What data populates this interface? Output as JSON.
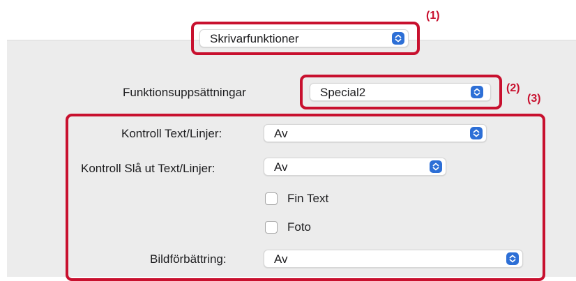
{
  "top_popup": {
    "value": "Skrivarfunktioner",
    "icon": "up-down-chevron-icon"
  },
  "feature_sets": {
    "label": "Funktionsuppsättningar",
    "value": "Special2",
    "icon": "up-down-chevron-icon"
  },
  "settings": {
    "text_lines_control": {
      "label": "Kontroll Text/Linjer:",
      "value": "Av"
    },
    "knockout_text_lines": {
      "label": "Kontroll Slå ut Text/Linjer:",
      "value": "Av"
    },
    "fine_text": {
      "label": "Fin Text",
      "checked": false
    },
    "photo": {
      "label": "Foto",
      "checked": false
    },
    "image_enhancement": {
      "label": "Bildförbättring:",
      "value": "Av"
    }
  },
  "callouts": {
    "c1": "(1)",
    "c2": "(2)",
    "c3": "(3)"
  },
  "colors": {
    "callout_red": "#c8102e",
    "accent_blue": "#2d6fd6",
    "panel_bg": "#ececec"
  }
}
